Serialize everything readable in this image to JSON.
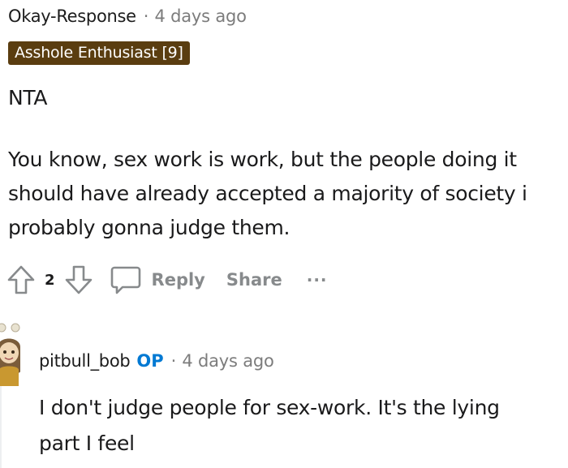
{
  "comment": {
    "author": "Okay-Response",
    "separator": "·",
    "time": "4 days ago",
    "flair": "Asshole Enthusiast [9]",
    "verdict": "NTA",
    "lines": [
      "You know, sex work is work, but the people doing it",
      "should have already accepted a majority of society i",
      "probably gonna judge them."
    ],
    "actions": {
      "upvote_icon": "arrow-up-icon",
      "score": "2",
      "downvote_icon": "arrow-down-icon",
      "reply_icon": "speech-bubble-icon",
      "reply_label": "Reply",
      "share_label": "Share",
      "more_label": "···"
    }
  },
  "reply": {
    "avatar_icon": "user-avatar-icon",
    "author": "pitbull_bob",
    "op_badge": "OP",
    "separator": "·",
    "time": "4 days ago",
    "lines": [
      "I don't judge people for sex-work. It's the lying",
      "part I feel"
    ]
  },
  "colors": {
    "flair_bg": "#5a3d10",
    "op_badge": "#0079d3",
    "muted": "#878a8c"
  }
}
